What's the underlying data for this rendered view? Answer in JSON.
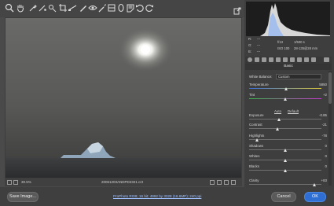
{
  "toolbar": {
    "tools": [
      "zoom-icon",
      "hand-icon",
      "white-balance-icon",
      "color-sampler-icon",
      "targeted-adjust-icon",
      "crop-icon",
      "straighten-icon",
      "spot-removal-icon",
      "red-eye-icon",
      "adjustment-brush-icon",
      "graduated-filter-icon",
      "radial-filter-icon",
      "preferences-icon",
      "rotate-ccw-icon",
      "rotate-cw-icon"
    ],
    "open_panel_icon": "export-icon"
  },
  "status_bar": {
    "zoom": "30.5%",
    "filename": "20061203ANDPD2321.cr2"
  },
  "bottom": {
    "save_label": "Save Image...",
    "info": "ProPhoto RGB; 16 bit; 4992 by 3328 (16.6MP); 240 ppi",
    "cancel_label": "Cancel",
    "ok_label": "OK"
  },
  "readout": {
    "r_label": "R:",
    "r_value": "---",
    "g_label": "G:",
    "g_value": "---",
    "b_label": "B:",
    "b_value": "---",
    "aperture": "f/13",
    "shutter": "1/500 s",
    "iso": "ISO 100",
    "lens": "28-135@28 mm"
  },
  "panel": {
    "section_title": "Basic",
    "white_balance_label": "White Balance:",
    "white_balance_value": "Custom",
    "auto_label": "Auto",
    "default_label": "Default",
    "sliders": [
      {
        "name": "temperature",
        "label": "Temperature",
        "value": "5850",
        "position": 0.52
      },
      {
        "name": "tint",
        "label": "Tint",
        "value": "+2",
        "position": 0.51
      },
      {
        "name": "exposure",
        "label": "Exposure",
        "value": "-0.85",
        "position": 0.42
      },
      {
        "name": "contrast",
        "label": "Contrast",
        "value": "-21",
        "position": 0.4
      },
      {
        "name": "highlights",
        "label": "Highlights",
        "value": "-78",
        "position": 0.11
      },
      {
        "name": "shadows",
        "label": "Shadows",
        "value": "0",
        "position": 0.5
      },
      {
        "name": "whites",
        "label": "Whites",
        "value": "0",
        "position": 0.5
      },
      {
        "name": "blacks",
        "label": "Blacks",
        "value": "0",
        "position": 0.5
      },
      {
        "name": "clarity",
        "label": "Clarity",
        "value": "+83",
        "position": 0.91
      }
    ]
  },
  "colors": {
    "accent": "#2f6fd4",
    "panel_bg": "#3e3e3e",
    "app_bg": "#4a4a4a"
  }
}
